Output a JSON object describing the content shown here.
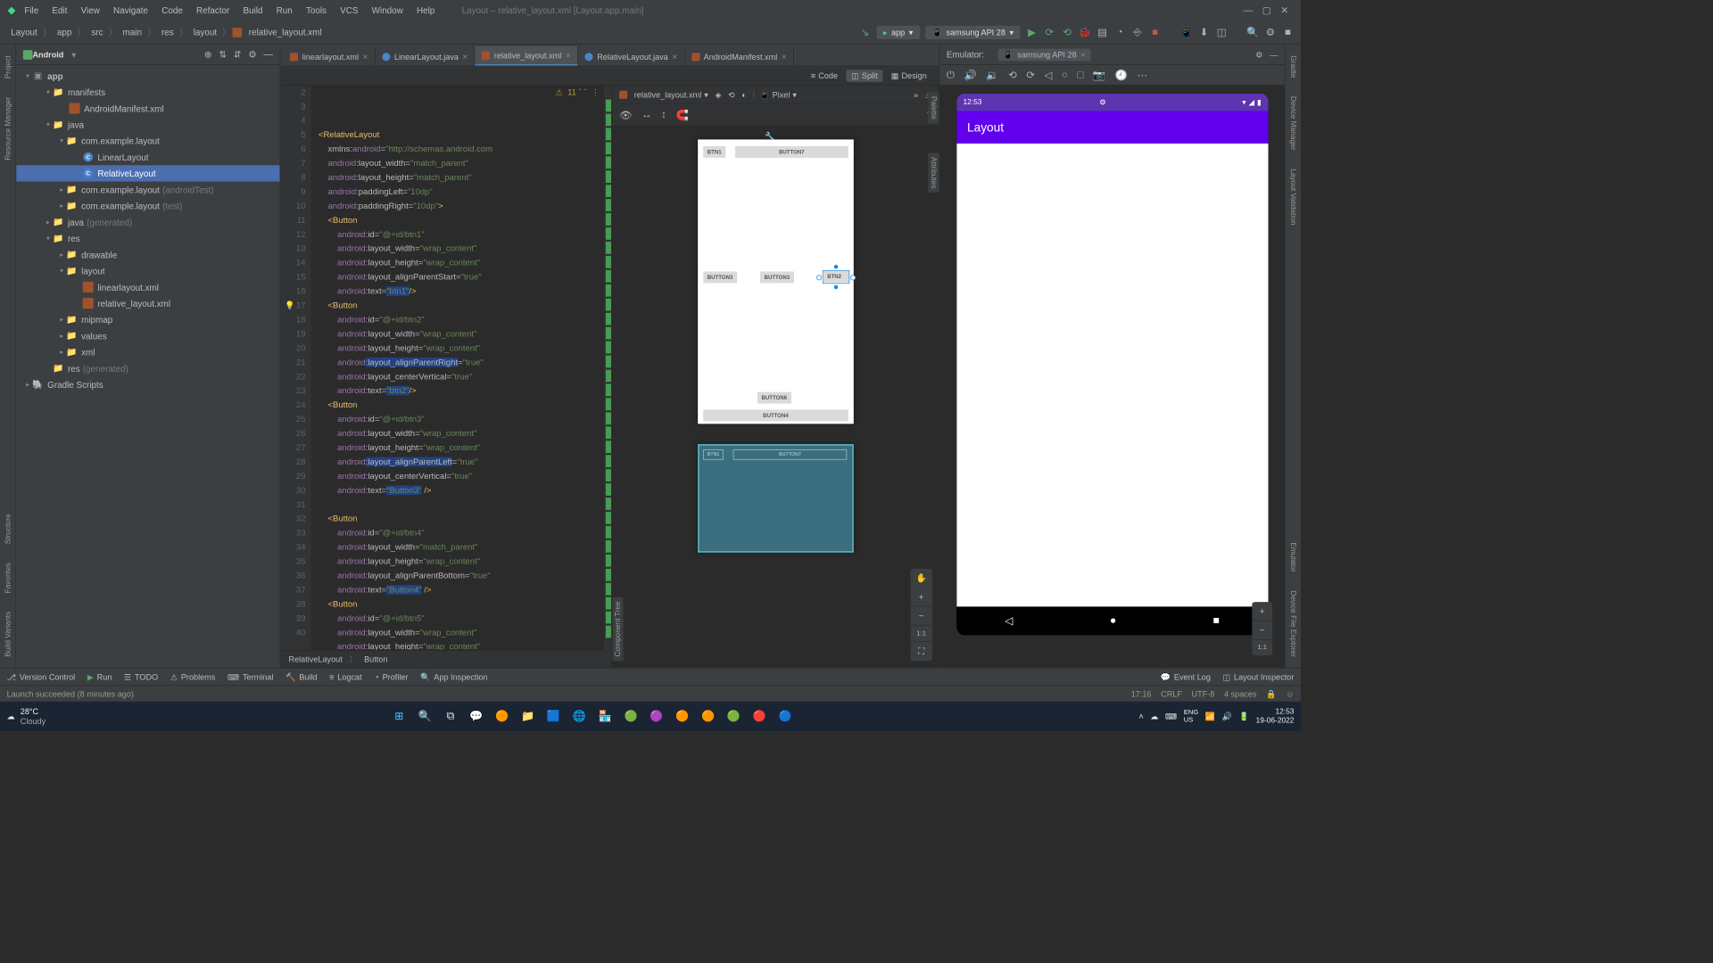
{
  "window_title": "Layout – relative_layout.xml [Layout.app.main]",
  "menu": [
    "File",
    "Edit",
    "View",
    "Navigate",
    "Code",
    "Refactor",
    "Build",
    "Run",
    "Tools",
    "VCS",
    "Window",
    "Help"
  ],
  "breadcrumb": [
    "Layout",
    "app",
    "src",
    "main",
    "res",
    "layout",
    "relative_layout.xml"
  ],
  "run_config": {
    "app": "app",
    "device": "samsung API 28"
  },
  "left_vtabs": [
    "Project",
    "Resource Manager",
    "Structure",
    "Favorites",
    "Build Variants"
  ],
  "right_vtabs": [
    "Gradle",
    "Device Manager",
    "Layout Validation",
    "Emulator",
    "Device File Explorer"
  ],
  "project_panel": {
    "title": "Android",
    "tree": {
      "app": "app",
      "manifests": "manifests",
      "manifest_file": "AndroidManifest.xml",
      "java": "java",
      "pkg_main": "com.example.layout",
      "cls_linear": "LinearLayout",
      "cls_relative": "RelativeLayout",
      "pkg_atest": "com.example.layout",
      "pkg_atest_dim": "(androidTest)",
      "pkg_test": "com.example.layout",
      "pkg_test_dim": "(test)",
      "java_gen": "java",
      "java_gen_dim": "(generated)",
      "res": "res",
      "drawable": "drawable",
      "layout_dir": "layout",
      "linearlayout_xml": "linearlayout.xml",
      "relative_layout_xml": "relative_layout.xml",
      "mipmap": "mipmap",
      "values": "values",
      "xml_dir": "xml",
      "res_gen": "res",
      "res_gen_dim": "(generated)",
      "gradle": "Gradle Scripts"
    }
  },
  "editor_tabs": [
    {
      "name": "linearlayout.xml",
      "type": "xml"
    },
    {
      "name": "LinearLayout.java",
      "type": "java"
    },
    {
      "name": "relative_layout.xml",
      "type": "xml",
      "active": true
    },
    {
      "name": "RelativeLayout.java",
      "type": "java"
    },
    {
      "name": "AndroidManifest.xml",
      "type": "xml"
    }
  ],
  "view_modes": {
    "code": "Code",
    "split": "Split",
    "design": "Design"
  },
  "warnings_count": "11",
  "code_lines_start": 2,
  "code_footer": {
    "a": "RelativeLayout",
    "b": "Button"
  },
  "design_toolbar": {
    "file": "relative_layout.xml",
    "device": "Pixel"
  },
  "design_side_labels": {
    "palette": "Palette",
    "attributes": "Attributes",
    "component_tree": "Component Tree"
  },
  "preview_buttons": {
    "b1": "BTN1",
    "b7": "BUTTON7",
    "b3a": "BUTTON3",
    "b3b": "BUTTON3",
    "b2": "BTN2",
    "b6": "BUTTON6",
    "b4": "BUTTON4"
  },
  "emulator": {
    "title": "Emulator:",
    "device": "samsung API 28",
    "status_time": "12:53",
    "app_title": "Layout"
  },
  "bottom_tabs": {
    "vcs": "Version Control",
    "run": "Run",
    "todo": "TODO",
    "problems": "Problems",
    "terminal": "Terminal",
    "build": "Build",
    "logcat": "Logcat",
    "profiler": "Profiler",
    "inspection": "App Inspection",
    "eventlog": "Event Log",
    "layout_inspector": "Layout Inspector"
  },
  "status": {
    "msg": "Launch succeeded (8 minutes ago)",
    "time": "17:16",
    "lf": "CRLF",
    "enc": "UTF-8",
    "indent": "4 spaces"
  },
  "taskbar": {
    "temp": "28°C",
    "cond": "Cloudy",
    "lang_top": "ENG",
    "lang_bot": "US",
    "clock_time": "12:53",
    "clock_date": "19-06-2022"
  }
}
